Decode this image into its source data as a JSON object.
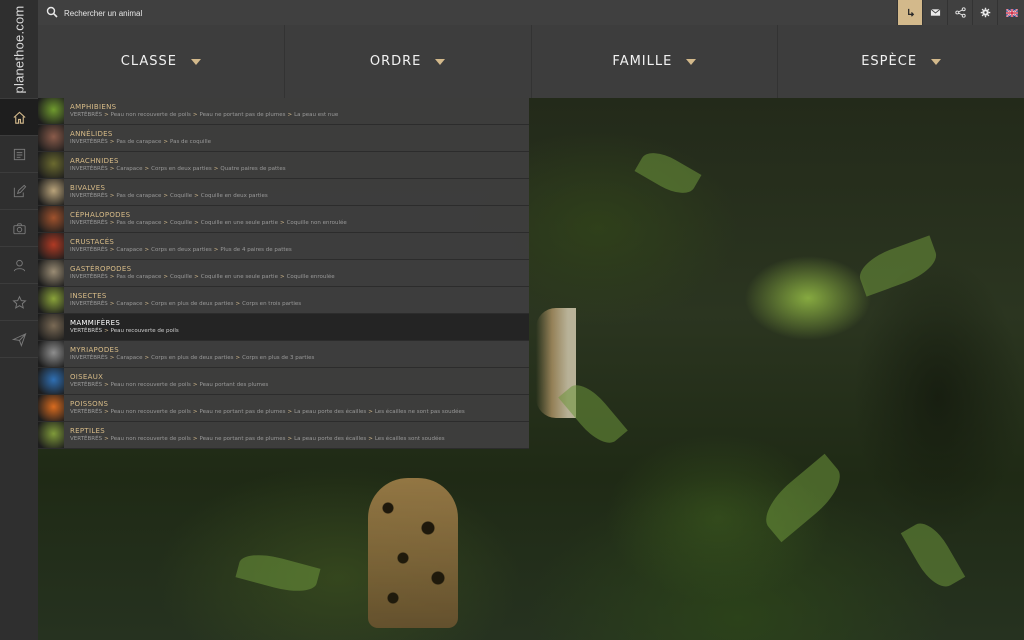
{
  "sidebar": {
    "logo": "planethoe.com",
    "items": [
      {
        "icon": "home-icon",
        "active": true
      },
      {
        "icon": "list-icon",
        "active": false
      },
      {
        "icon": "edit-icon",
        "active": false
      },
      {
        "icon": "camera-icon",
        "active": false
      },
      {
        "icon": "user-icon",
        "active": false
      },
      {
        "icon": "star-icon",
        "active": false
      },
      {
        "icon": "send-icon",
        "active": false
      }
    ]
  },
  "topbar": {
    "search_placeholder": "Rechercher un animal",
    "buttons": [
      "return-icon",
      "mail-icon",
      "share-icon",
      "gear-icon",
      "uk-flag-icon"
    ]
  },
  "taxonomy": {
    "classe": "CLASSE",
    "ordre": "ORDRE",
    "famille": "FAMILLE",
    "espece": "ESPÈCE"
  },
  "dropdown": {
    "items": [
      {
        "name": "AMPHIBIENS",
        "path": [
          "VERTÉBRÉS",
          "Peau non recouverte de poils",
          "Peau ne portant pas de plumes",
          "La peau est nue"
        ],
        "color": "#6f9a2e"
      },
      {
        "name": "ANNÉLIDES",
        "path": [
          "INVERTÉBRÉS",
          "Pas de carapace",
          "Pas de coquille"
        ],
        "color": "#8a5b4a"
      },
      {
        "name": "ARACHNIDES",
        "path": [
          "INVERTÉBRÉS",
          "Carapace",
          "Corps en deux parties",
          "Quatre paires de pattes"
        ],
        "color": "#6b6a2f"
      },
      {
        "name": "BIVALVES",
        "path": [
          "INVERTÉBRÉS",
          "Pas de carapace",
          "Coquille",
          "Coquille en deux parties"
        ],
        "color": "#b9a37a"
      },
      {
        "name": "CÉPHALOPODES",
        "path": [
          "INVERTÉBRÉS",
          "Pas de carapace",
          "Coquille",
          "Coquille en une seule partie",
          "Coquille non enroulée"
        ],
        "color": "#a0522d"
      },
      {
        "name": "CRUSTACÉS",
        "path": [
          "INVERTÉBRÉS",
          "Carapace",
          "Corps en deux parties",
          "Plus de 4 paires de pattes"
        ],
        "color": "#b03a24"
      },
      {
        "name": "GASTÉROPODES",
        "path": [
          "INVERTÉBRÉS",
          "Pas de carapace",
          "Coquille",
          "Coquille en une seule partie",
          "Coquille enroulée"
        ],
        "color": "#9a8c74"
      },
      {
        "name": "INSECTES",
        "path": [
          "INVERTÉBRÉS",
          "Carapace",
          "Corps en plus de deux parties",
          "Corps en trois parties"
        ],
        "color": "#8aa33a"
      },
      {
        "name": "MAMMIFÈRES",
        "path": [
          "VERTÉBRÉS",
          "Peau recouverte de poils"
        ],
        "color": "#7a6a55",
        "selected": true
      },
      {
        "name": "MYRIAPODES",
        "path": [
          "INVERTÉBRÉS",
          "Carapace",
          "Corps en plus de deux parties",
          "Corps en plus de 3 parties"
        ],
        "color": "#8e8e8e"
      },
      {
        "name": "OISEAUX",
        "path": [
          "VERTÉBRÉS",
          "Peau non recouverte de poils",
          "Peau portant des plumes"
        ],
        "color": "#2f6fb3"
      },
      {
        "name": "POISSONS",
        "path": [
          "VERTÉBRÉS",
          "Peau non recouverte de poils",
          "Peau ne portant pas de plumes",
          "La peau porte des écailles",
          "Les écailles ne sont pas soudées"
        ],
        "color": "#d96b1f"
      },
      {
        "name": "REPTILES",
        "path": [
          "VERTÉBRÉS",
          "Peau non recouverte de poils",
          "Peau ne portant pas de plumes",
          "La peau porte des écailles",
          "Les écailles sont soudées"
        ],
        "color": "#7f9a3a"
      }
    ]
  },
  "colors": {
    "accent": "#d3b98b",
    "panel": "#3d3d3d",
    "sidebar": "#2f2f2f"
  }
}
